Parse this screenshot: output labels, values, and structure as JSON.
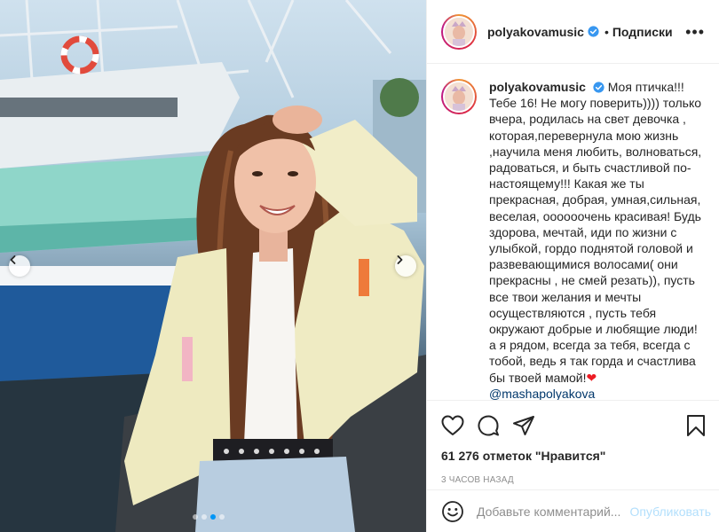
{
  "post": {
    "username": "polyakovamusic",
    "verified": true,
    "follow_label": "Подписки",
    "bullet": "•",
    "more_label": "•••"
  },
  "photo": {
    "prev_icon": "chevron-left-icon",
    "next_icon": "chevron-right-icon",
    "slides": 4,
    "active_slide": 1
  },
  "caption": {
    "username": "polyakovamusic",
    "text": "Моя птичка!!! Тебе 16! Не могу поверить)))) только вчера, родилась на свет девочка , которая,перевернула мою жизнь ,научила меня любить, волноваться, радоваться, и быть счастливой по-настоящему!!! Какая же ты прекрасная, добрая, умная,сильная, веселая, оооооочень красивая! Будь здорова, мечтай, иди по жизни с улыбкой, гордо поднятой головой и развевающимися волосами( они прекрасны , не смей резать)), пусть все твои желания и мечты осуществляются , пусть тебя окружают добрые и любящие люди! а я рядом, всегда за тебя, всегда с тобой, ведь я так горда и счастлива бы твоей мамой!",
    "heart": "❤",
    "mention": "@mashapolyakova"
  },
  "actions": {
    "like_icon": "heart-icon",
    "comment_icon": "comment-icon",
    "share_icon": "share-icon",
    "save_icon": "bookmark-icon",
    "likes_text": "61 276 отметок \"Нравится\"",
    "time_text": "3 часов назад"
  },
  "comment_box": {
    "emoji_icon": "emoji-icon",
    "placeholder": "Добавьте комментарий...",
    "publish_label": "Опубликовать"
  },
  "colors": {
    "verified_blue": "#3897f0",
    "link": "#00376b",
    "publish_disabled": "#b2dffc",
    "secondary_text": "#8e8e8e",
    "divider": "#efefef"
  }
}
